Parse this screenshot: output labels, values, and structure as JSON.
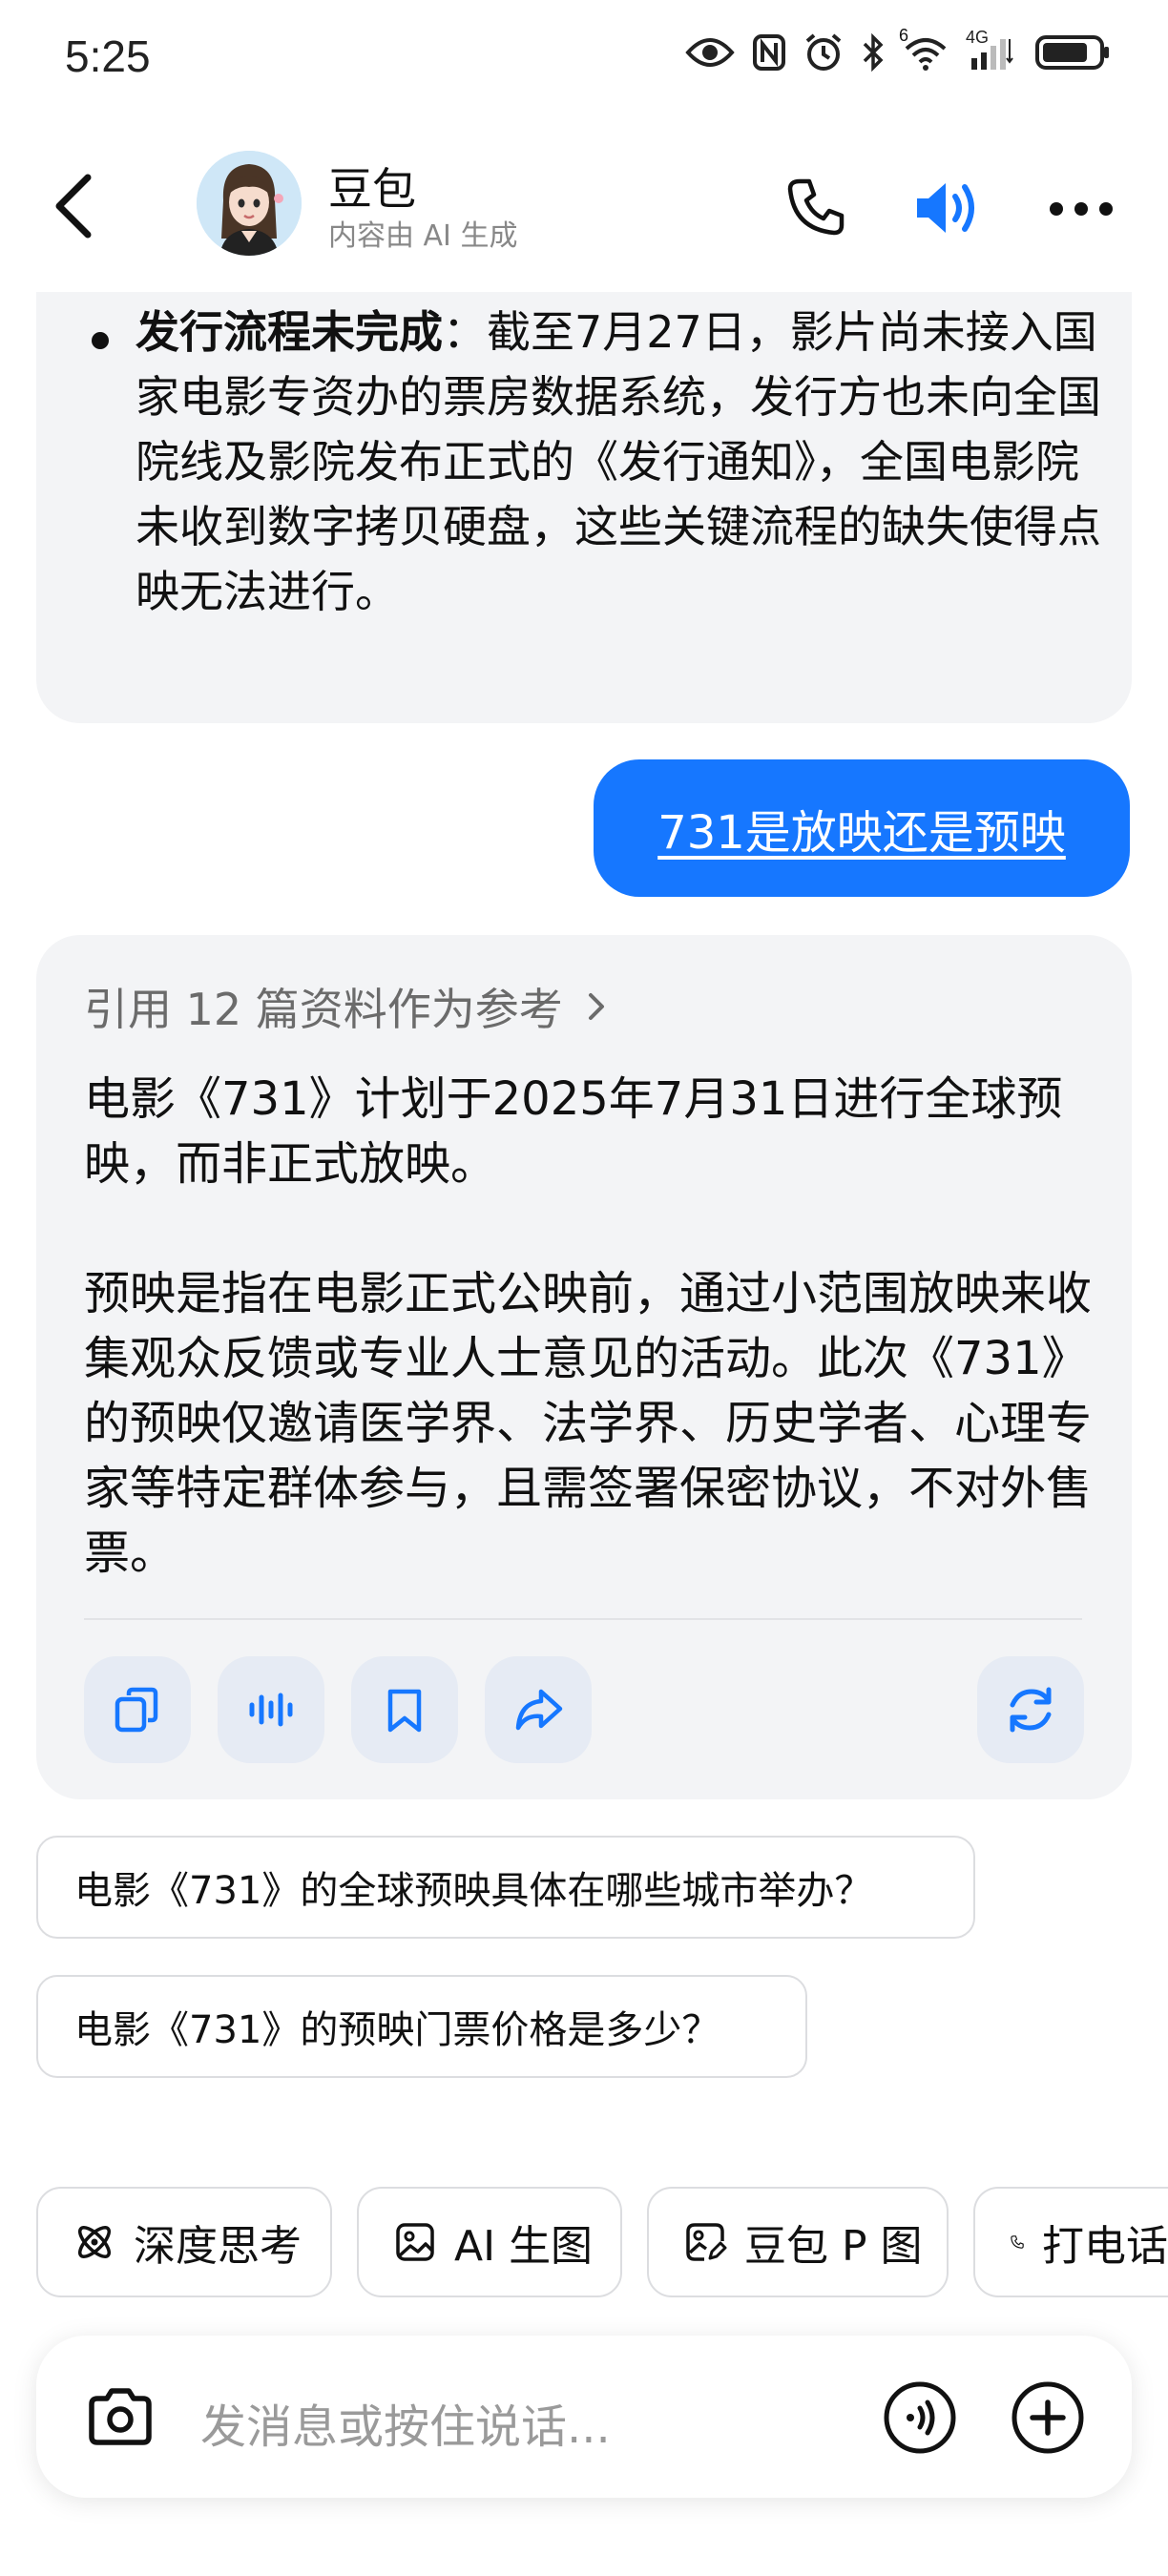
{
  "status_bar": {
    "time": "5:25",
    "network_superscript": "6",
    "network_label": "4G"
  },
  "header": {
    "title": "豆包",
    "subtitle": "内容由 AI 生成"
  },
  "previous_answer": {
    "bullet_title": "发行流程未完成",
    "bullet_body": "：截至7月27日，影片尚未接入国家电影专资办的票房数据系统，发行方也未向全国院线及影院发布正式的《发行通知》，全国电影院未收到数字拷贝硬盘，这些关键流程的缺失使得点映无法进行。"
  },
  "user_message": "731是放映还是预映",
  "answer": {
    "reference_label": "引用 12 篇资料作为参考",
    "paragraph1": "电影《731》计划于2025年7月31日进行全球预映，而非正式放映。",
    "paragraph2": "预映是指在电影正式公映前，通过小范围放映来收集观众反馈或专业人士意见的活动。此次《731》的预映仅邀请医学界、法学界、历史学者、心理专家等特定群体参与，且需签署保密协议，不对外售票。"
  },
  "suggestions": [
    "电影《731》的全球预映具体在哪些城市举办？",
    "电影《731》的预映门票价格是多少？"
  ],
  "tools": [
    {
      "label": "深度思考",
      "icon": "atom-icon"
    },
    {
      "label": "AI 生图",
      "icon": "image-icon"
    },
    {
      "label": "豆包 P 图",
      "icon": "image-edit-icon"
    },
    {
      "label": "打电话",
      "icon": "phone-icon"
    }
  ],
  "input": {
    "placeholder": "发消息或按住说话..."
  },
  "colors": {
    "accent": "#1677ff",
    "card_bg": "#f3f4f6",
    "action_bg": "#e6ebf4"
  }
}
